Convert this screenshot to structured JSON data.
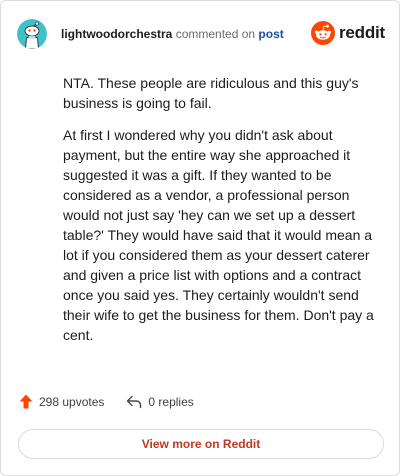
{
  "header": {
    "username": "lightwoodorchestra",
    "action": "commented on",
    "post_link": "post",
    "logo_text": "reddit"
  },
  "comment": {
    "paragraphs": [
      "NTA. These people are ridiculous and this guy's business is going to fail.",
      "At first I wondered why you didn't ask about payment, but the entire way she approached it suggested it was a gift. If they wanted to be considered as a vendor, a professional person would not just say 'hey can we set up a dessert table?' They would have said that it would mean a lot if you considered them as your dessert caterer and given a price list with options and a contract once you said yes. They certainly wouldn't send their wife to get the business for them. Don't pay a cent."
    ]
  },
  "footer": {
    "upvotes": "298 upvotes",
    "replies": "0 replies"
  },
  "view_more": "View more on Reddit",
  "colors": {
    "brand": "#ff4500",
    "link": "#1f4fa5",
    "avatar_bg": "#3ec1c9"
  },
  "icons": {
    "avatar": "snoo-avatar-icon",
    "logo": "reddit-logo-icon",
    "upvote": "upvote-arrow-icon",
    "reply": "reply-arrow-icon"
  }
}
